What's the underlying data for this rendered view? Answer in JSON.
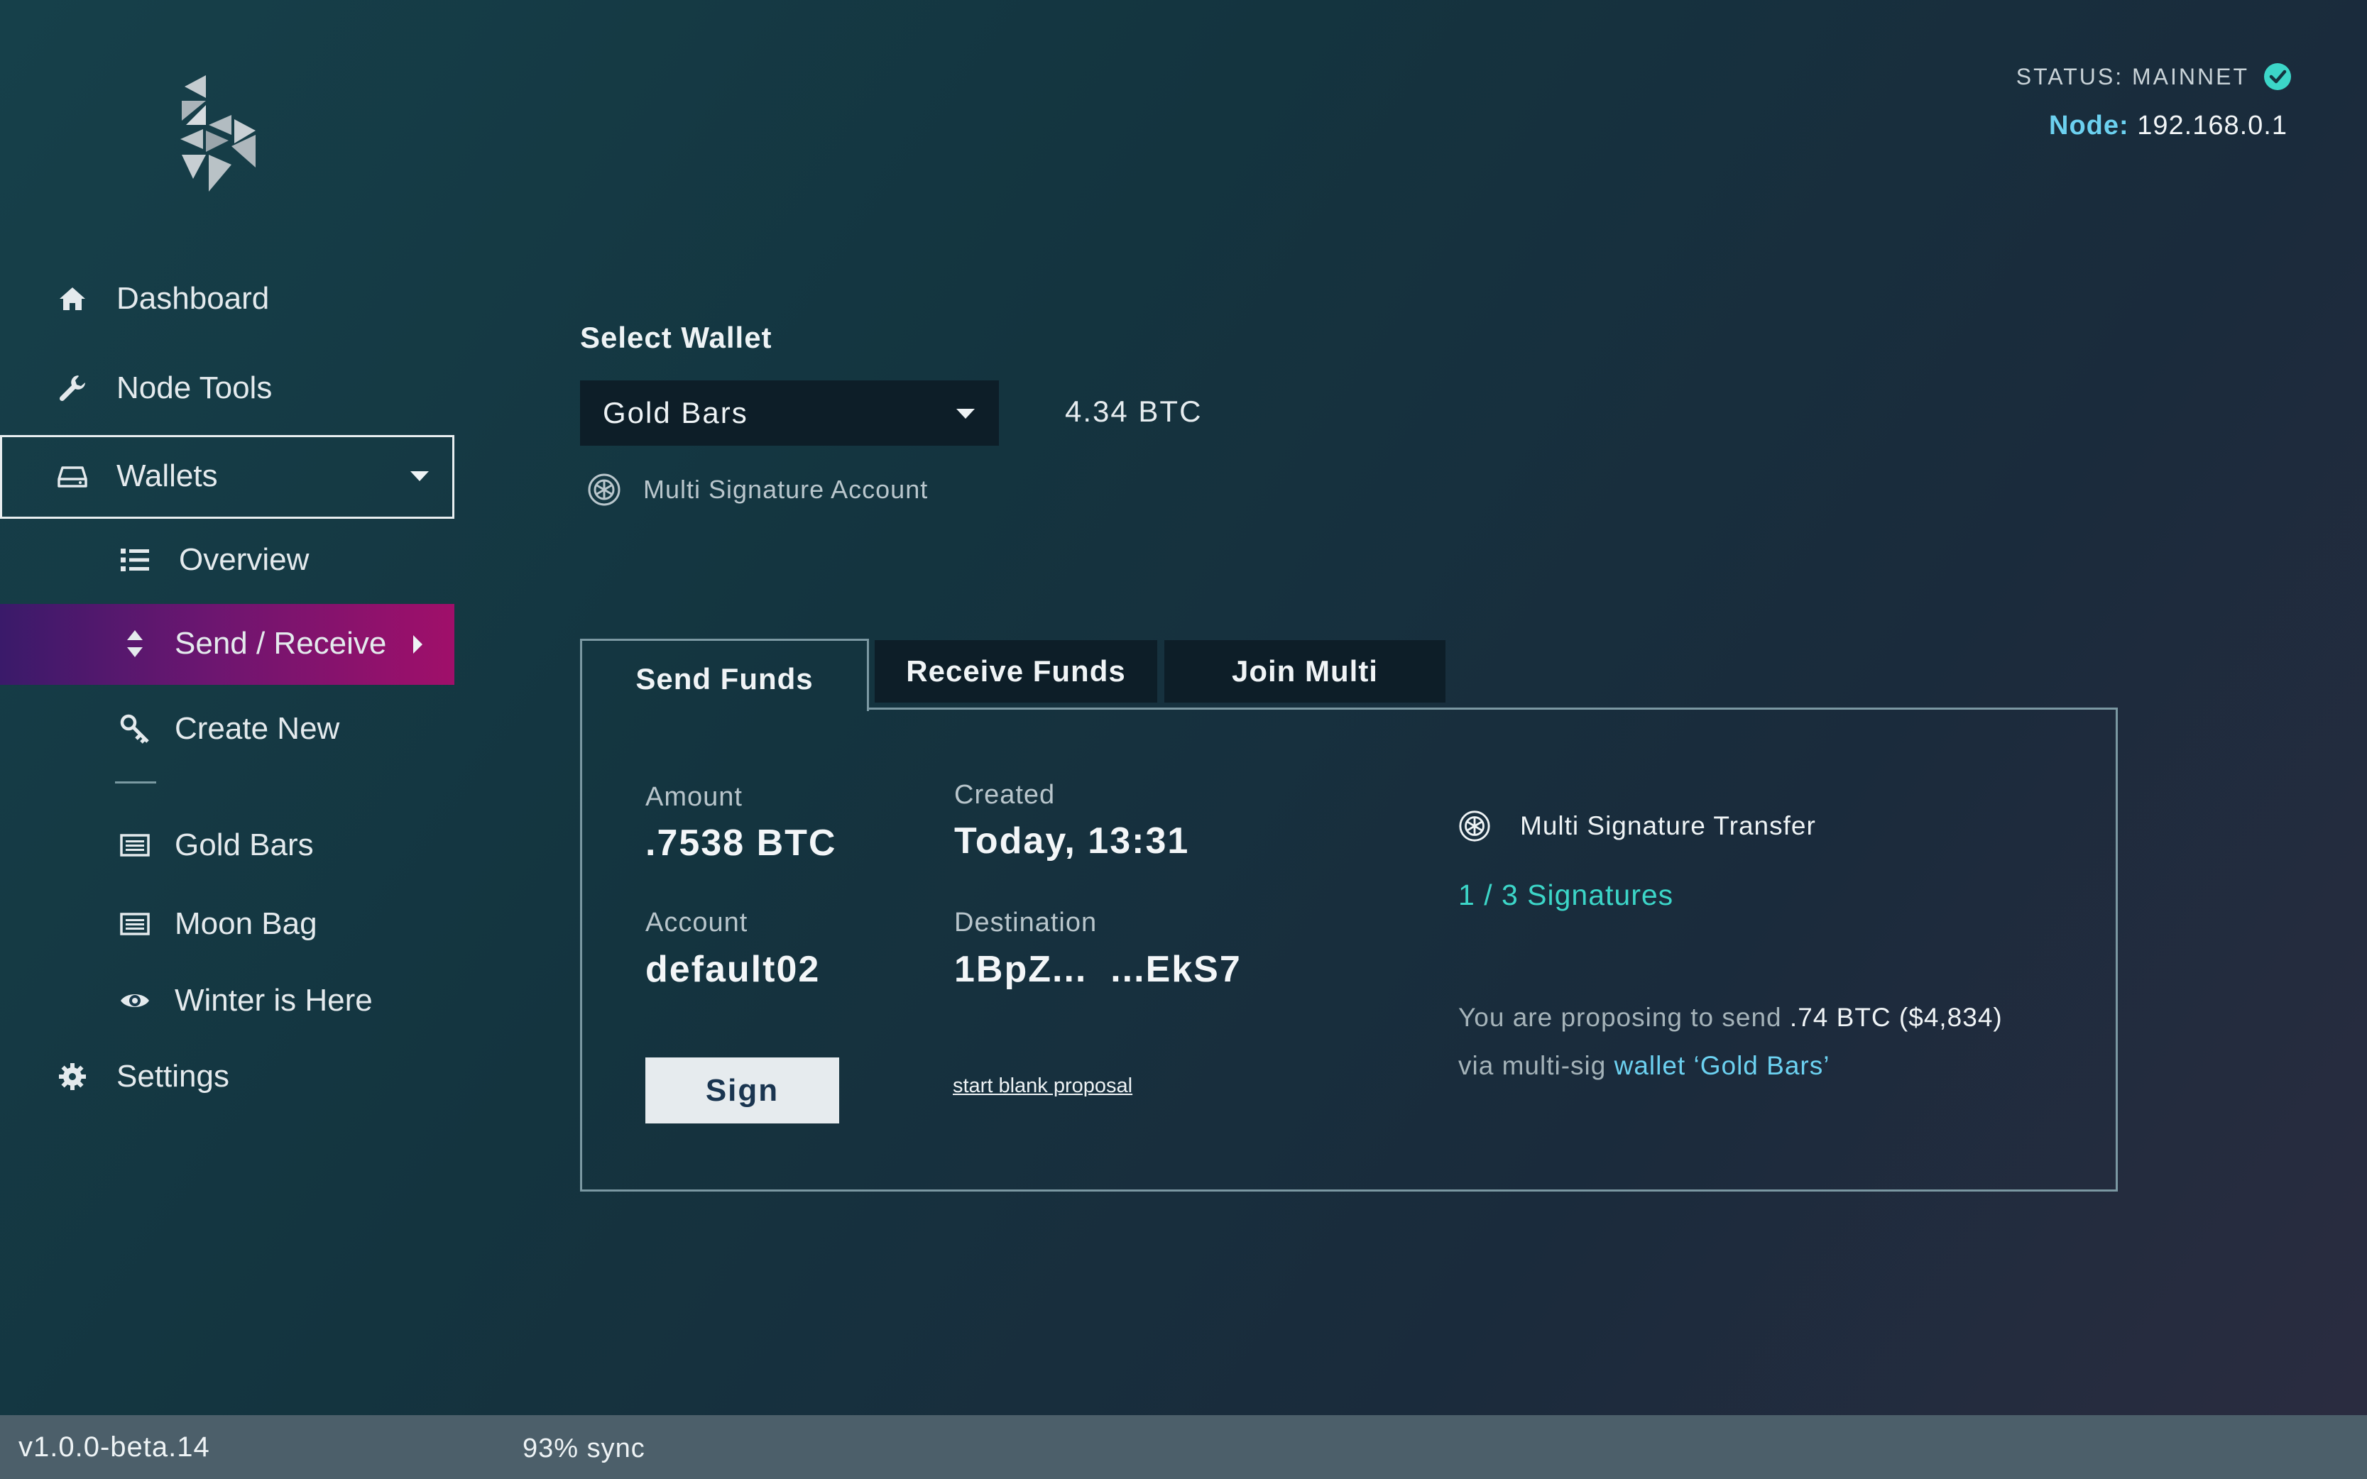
{
  "status": {
    "label": "STATUS: MAINNET",
    "node_label": "Node:",
    "node_value": "192.168.0.1"
  },
  "sidebar": {
    "items": [
      {
        "label": "Dashboard",
        "icon": "home-icon"
      },
      {
        "label": "Node Tools",
        "icon": "wrench-icon"
      },
      {
        "label": "Wallets",
        "icon": "drive-icon"
      },
      {
        "label": "Overview",
        "icon": "list-icon"
      },
      {
        "label": "Send / Receive",
        "icon": "sort-icon"
      },
      {
        "label": "Create New",
        "icon": "key-icon"
      },
      {
        "label": "Gold Bars",
        "icon": "wallet-card-icon"
      },
      {
        "label": "Moon Bag",
        "icon": "wallet-card-icon"
      },
      {
        "label": "Winter is Here",
        "icon": "eye-icon"
      },
      {
        "label": "Settings",
        "icon": "gear-icon"
      }
    ]
  },
  "wallet_select": {
    "label": "Select Wallet",
    "selected": "Gold Bars",
    "balance": "4.34 BTC",
    "account_type": "Multi Signature Account"
  },
  "tabs": {
    "send": "Send Funds",
    "receive": "Receive Funds",
    "join": "Join Multi"
  },
  "transfer": {
    "amount_label": "Amount",
    "amount_value": ".7538 BTC",
    "created_label": "Created",
    "created_value": "Today, 13:31",
    "account_label": "Account",
    "account_value": "default02",
    "destination_label": "Destination",
    "destination_value": "1BpZ...  ...EkS7",
    "sign_button": "Sign",
    "blank_proposal": "start blank proposal",
    "multi_title": "Multi Signature Transfer",
    "signatures": "1 / 3 Signatures",
    "proposal_prefix": "You are proposing to send ",
    "proposal_amount": ".74 BTC ($4,834)",
    "proposal_via": "via multi-sig ",
    "proposal_wallet": "wallet ‘Gold Bars’"
  },
  "footer": {
    "version": "v1.0.0-beta.14",
    "sync": "93% sync"
  },
  "colors": {
    "accent_cyan": "#3cd6c8",
    "link_blue": "#6cd1f0",
    "active_gradient_start": "#3a1a6a",
    "active_gradient_end": "#a00f6a"
  }
}
